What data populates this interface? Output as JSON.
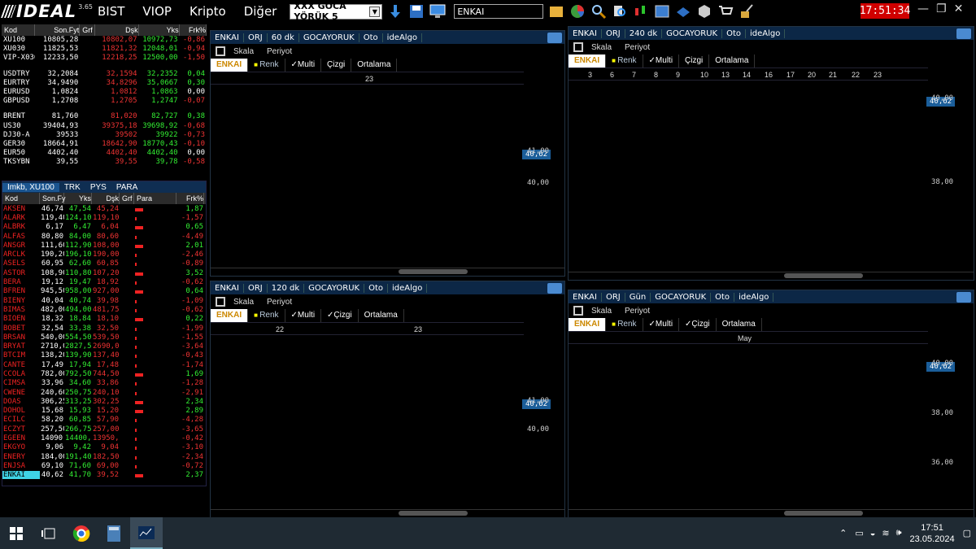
{
  "app": {
    "logo": "IDEAL",
    "version": "3.65",
    "menu": [
      "BIST",
      "VIOP",
      "Kripto",
      "Diğer"
    ],
    "layout_combo": "XXX GOCA YÖRÜK 5",
    "symbol_input": "ENKAI",
    "clock": "17:51:34"
  },
  "market": {
    "headers": [
      "Kod",
      "Son.Fyt",
      "Grf",
      "Dşk",
      "Yks",
      "Frk%"
    ],
    "groups": [
      [
        [
          "XU100",
          "10805,28",
          "10802,07",
          "10972,73",
          "-0,86"
        ],
        [
          "XU030",
          "11825,53",
          "11821,32",
          "12048,01",
          "-0,94"
        ],
        [
          "VIP-X030",
          "12233,50",
          "12218,25",
          "12500,00",
          "-1,50"
        ]
      ],
      [
        [
          "USDTRY",
          "32,2084",
          "32,1594",
          "32,2352",
          "0,04"
        ],
        [
          "EURTRY",
          "34,9490",
          "34,8296",
          "35,0667",
          "0,30"
        ],
        [
          "EURUSD",
          "1,0824",
          "1,0812",
          "1,0863",
          "0,00"
        ],
        [
          "GBPUSD",
          "1,2708",
          "1,2705",
          "1,2747",
          "-0,07"
        ]
      ],
      [
        [
          "BRENT",
          "81,760",
          "81,020",
          "82,727",
          "0,38"
        ],
        [
          "US30",
          "39404,93",
          "39375,18",
          "39698,92",
          "-0,68"
        ],
        [
          "DJ30-A",
          "39533",
          "39502",
          "39922",
          "-0,73"
        ],
        [
          "GER30",
          "18664,91",
          "18642,90",
          "18770,43",
          "-0,10"
        ],
        [
          "EUR50",
          "4402,40",
          "4402,40",
          "4402,40",
          "0,00"
        ],
        [
          "TKSYBN",
          "39,55",
          "39,55",
          "39,78",
          "-0,58"
        ]
      ]
    ]
  },
  "list": {
    "tabs": [
      "Imkb, XU100",
      "TRK",
      "PYS",
      "PARA"
    ],
    "headers": [
      "Kod",
      "Son.Fy",
      "Yks",
      "Dşk",
      "Grf",
      "Para",
      "Frk%"
    ],
    "rows": [
      [
        "AKSEN",
        "46,74",
        "47,54",
        "45,24",
        "1,87"
      ],
      [
        "ALARK",
        "119,40",
        "124,10",
        "119,10",
        "-1,57"
      ],
      [
        "ALBRK",
        "6,17",
        "6,47",
        "6,04",
        "0,65"
      ],
      [
        "ALFAS",
        "80,80",
        "84,00",
        "80,60",
        "-4,49"
      ],
      [
        "ANSGR",
        "111,60",
        "112,90",
        "108,00",
        "2,01"
      ],
      [
        "ARCLK",
        "190,20",
        "196,10",
        "190,00",
        "-2,46"
      ],
      [
        "ASELS",
        "60,95",
        "62,60",
        "60,85",
        "-0,89"
      ],
      [
        "ASTOR",
        "108,90",
        "110,80",
        "107,20",
        "3,52"
      ],
      [
        "BERA",
        "19,12",
        "19,47",
        "18,92",
        "-0,62"
      ],
      [
        "BFREN",
        "945,50",
        "958,00",
        "927,00",
        "0,64"
      ],
      [
        "BIENY",
        "40,04",
        "40,74",
        "39,98",
        "-1,09"
      ],
      [
        "BIMAS",
        "482,00",
        "494,00",
        "481,75",
        "-0,62"
      ],
      [
        "BIOEN",
        "18,32",
        "18,84",
        "18,10",
        "0,22"
      ],
      [
        "BOBET",
        "32,54",
        "33,38",
        "32,50",
        "-1,99"
      ],
      [
        "BRSAN",
        "540,00",
        "554,50",
        "539,50",
        "-1,55"
      ],
      [
        "BRYAT",
        "2710,0",
        "2827,5",
        "2690,0",
        "-3,64"
      ],
      [
        "BTCIM",
        "138,20",
        "139,90",
        "137,40",
        "-0,43"
      ],
      [
        "CANTE",
        "17,49",
        "17,94",
        "17,48",
        "-1,74"
      ],
      [
        "CCOLA",
        "782,00",
        "792,50",
        "744,50",
        "1,69"
      ],
      [
        "CIMSA",
        "33,96",
        "34,60",
        "33,86",
        "-1,28"
      ],
      [
        "CWENE",
        "240,60",
        "250,75",
        "240,10",
        "-2,91"
      ],
      [
        "DOAS",
        "306,25",
        "313,25",
        "302,25",
        "2,34"
      ],
      [
        "DOHOL",
        "15,68",
        "15,93",
        "15,20",
        "2,89"
      ],
      [
        "ECILC",
        "58,20",
        "60,85",
        "57,90",
        "-4,28"
      ],
      [
        "ECZYT",
        "257,50",
        "266,75",
        "257,00",
        "-3,65"
      ],
      [
        "EGEEN",
        "14090,",
        "14400,",
        "13950,",
        "-0,42"
      ],
      [
        "EKGYO",
        "9,06",
        "9,42",
        "9,04",
        "-3,10"
      ],
      [
        "ENERY",
        "184,00",
        "191,40",
        "182,50",
        "-2,34"
      ],
      [
        "ENJSA",
        "69,10",
        "71,60",
        "69,00",
        "-0,72"
      ],
      [
        "ENKAI",
        "40,62",
        "41,70",
        "39,52",
        "2,37"
      ]
    ]
  },
  "charts": [
    {
      "id": "c60",
      "title": [
        "ENKAI",
        "ORJ",
        "60 dk",
        "GOCAYORUK",
        "Oto",
        "ideAlgo"
      ],
      "tools": [
        "Skala",
        "Periyot"
      ],
      "tabs": [
        "ENKAI",
        "Renk",
        "✓Multi",
        "Çizgi",
        "Ortalama"
      ],
      "top_labels": [
        "23"
      ],
      "price": "40,62",
      "y_labels": [
        "41,00",
        "40,00"
      ]
    },
    {
      "id": "c240",
      "title": [
        "ENKAI",
        "ORJ",
        "240 dk",
        "GOCAYORUK",
        "Oto",
        "ideAlgo"
      ],
      "tools": [
        "Skala",
        "Periyot"
      ],
      "tabs": [
        "ENKAI",
        "Renk",
        "✓Multi",
        "Çizgi",
        "Ortalama"
      ],
      "top_labels": [
        "3",
        "6",
        "7",
        "8",
        "9",
        "10",
        "13",
        "14",
        "16",
        "17",
        "20",
        "21",
        "22",
        "23"
      ],
      "price": "40,62",
      "y_labels": [
        "40,00",
        "38,00"
      ]
    },
    {
      "id": "c120",
      "title": [
        "ENKAI",
        "ORJ",
        "120 dk",
        "GOCAYORUK",
        "Oto",
        "ideAlgo"
      ],
      "tools": [
        "Skala",
        "Periyot"
      ],
      "tabs": [
        "ENKAI",
        "Renk",
        "✓Multi",
        "✓Çizgi",
        "Ortalama"
      ],
      "top_labels": [
        "22",
        "23"
      ],
      "price": "40,62",
      "y_labels": [
        "41,00",
        "40,00"
      ]
    },
    {
      "id": "cday",
      "title": [
        "ENKAI",
        "ORJ",
        "Gün",
        "GOCAYORUK",
        "Oto",
        "ideAlgo"
      ],
      "tools": [
        "Skala",
        "Periyot"
      ],
      "tabs": [
        "ENKAI",
        "Renk",
        "✓Multi",
        "✓Çizgi",
        "Ortalama"
      ],
      "top_labels": [
        "May"
      ],
      "price": "40,62",
      "y_labels": [
        "40,00",
        "38,00",
        "36,00"
      ]
    }
  ],
  "taskbar": {
    "time": "17:51",
    "date": "23.05.2024"
  },
  "colors": {
    "up": "#35f035",
    "down": "#e83030",
    "ma_fast": "#1f1fe8",
    "ma_slow": "#e80000",
    "accent": "#1b5e9a"
  }
}
